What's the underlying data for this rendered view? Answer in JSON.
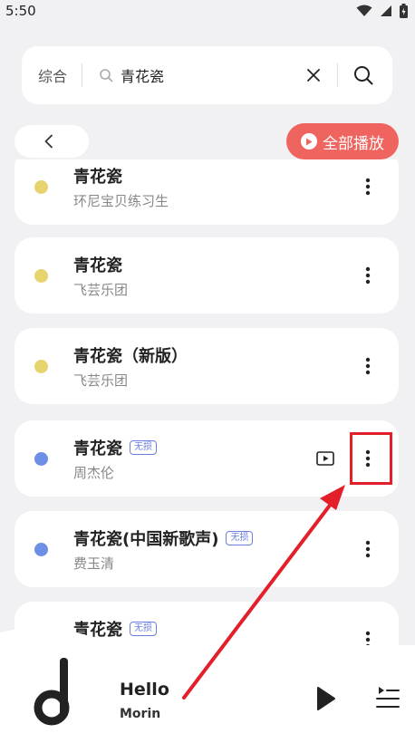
{
  "status_bar": {
    "time": "5:50"
  },
  "search": {
    "category": "综合",
    "query": "青花瓷"
  },
  "toolbar": {
    "play_all_label": "全部播放"
  },
  "songs": [
    {
      "title": "青花瓷",
      "artist": "环尼宝贝练习生",
      "badge": "",
      "dot_color": "#e6d46e",
      "has_mv": false
    },
    {
      "title": "青花瓷",
      "artist": "飞芸乐团",
      "badge": "",
      "dot_color": "#e6d46e",
      "has_mv": false
    },
    {
      "title": "青花瓷（新版）",
      "artist": "飞芸乐团",
      "badge": "",
      "dot_color": "#e6d46e",
      "has_mv": false
    },
    {
      "title": "青花瓷",
      "artist": "周杰伦",
      "badge": "无损",
      "dot_color": "#6e8fe6",
      "has_mv": true
    },
    {
      "title": "青花瓷(中国新歌声)",
      "artist": "费玉清",
      "badge": "无损",
      "dot_color": "#6e8fe6",
      "has_mv": false
    },
    {
      "title": "青花瓷",
      "artist": "",
      "badge": "无损",
      "dot_color": "#6e8fe6",
      "has_mv": false
    }
  ],
  "player": {
    "title": "Hello",
    "artist": "Morin"
  },
  "colors": {
    "accent": "#f0645f",
    "highlight": "#e3202a",
    "badge": "#6b7fe0"
  }
}
